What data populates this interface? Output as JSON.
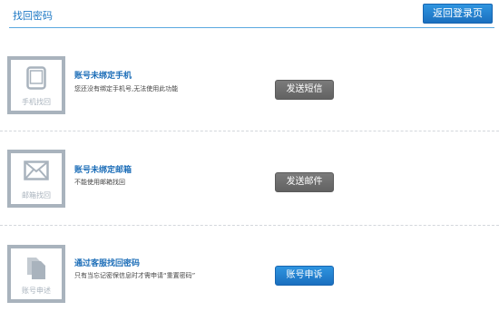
{
  "header": {
    "title": "找回密码",
    "back_label": "返回登录页"
  },
  "options": [
    {
      "icon_label": "手机找回",
      "title": "账号未绑定手机",
      "description": "您还没有绑定手机号,无法使用此功能",
      "button_label": "发送短信",
      "button_style": "disabled-gray"
    },
    {
      "icon_label": "邮箱找回",
      "title": "账号未绑定邮箱",
      "description": "不能使用邮箱找回",
      "button_label": "发送邮件",
      "button_style": "disabled-gray"
    },
    {
      "icon_label": "账号申述",
      "title": "通过客服找回密码",
      "description": "只有当忘记密保信息时才需申请“重置密码”",
      "button_label": "账号申诉",
      "button_style": "active-blue"
    }
  ],
  "colors": {
    "accent": "#1d78c4",
    "icon_gray": "#a9b3bd",
    "button_gray": "#6e6e6e",
    "button_blue": "#2283d3"
  }
}
